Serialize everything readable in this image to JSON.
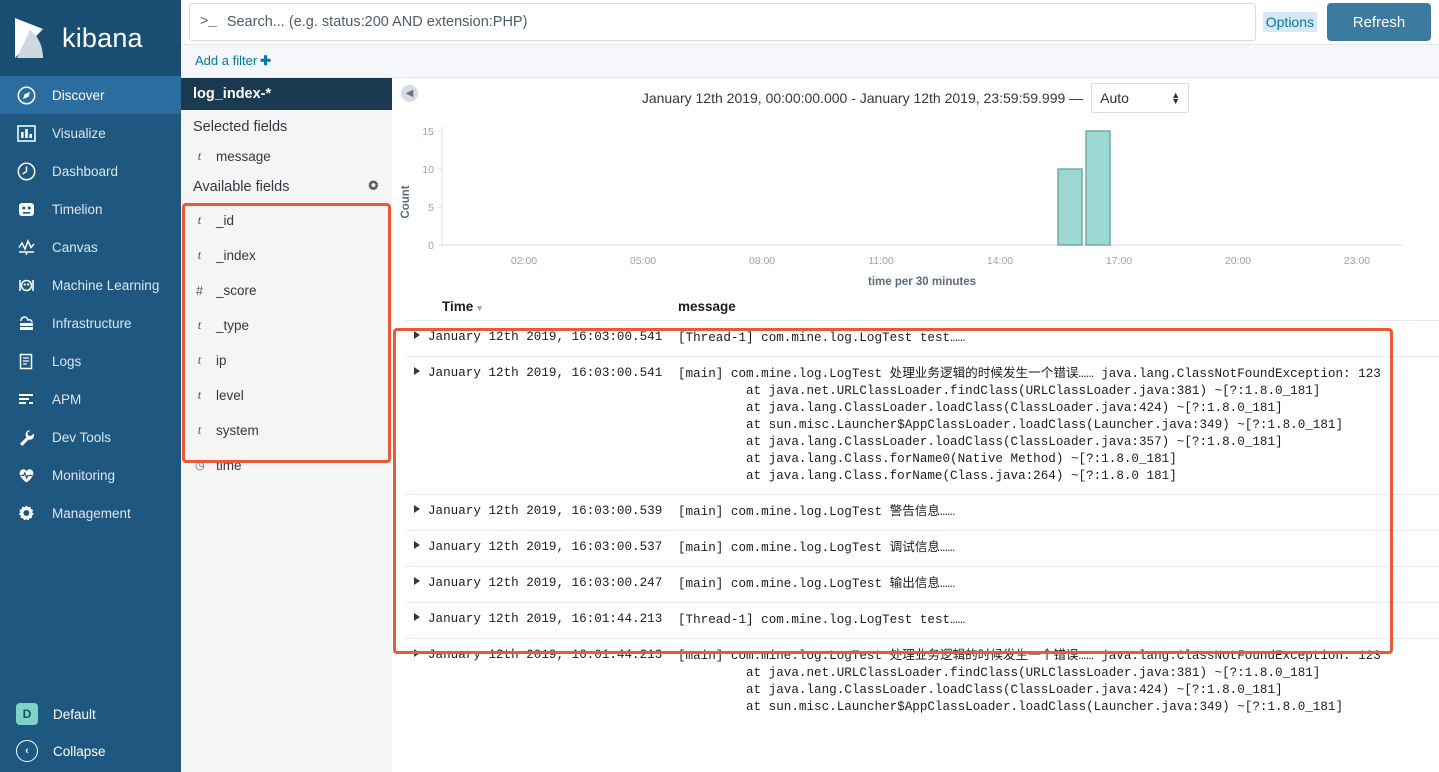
{
  "brand": {
    "name": "kibana",
    "logo_icon": "kibana-logo"
  },
  "nav": {
    "items": [
      {
        "label": "Discover",
        "icon": "compass-icon",
        "active": true
      },
      {
        "label": "Visualize",
        "icon": "bar-chart-icon",
        "active": false
      },
      {
        "label": "Dashboard",
        "icon": "dashboard-icon",
        "active": false
      },
      {
        "label": "Timelion",
        "icon": "timelion-icon",
        "active": false
      },
      {
        "label": "Canvas",
        "icon": "canvas-icon",
        "active": false
      },
      {
        "label": "Machine Learning",
        "icon": "machine-learning-icon",
        "active": false
      },
      {
        "label": "Infrastructure",
        "icon": "infrastructure-icon",
        "active": false
      },
      {
        "label": "Logs",
        "icon": "logs-icon",
        "active": false
      },
      {
        "label": "APM",
        "icon": "apm-icon",
        "active": false
      },
      {
        "label": "Dev Tools",
        "icon": "wrench-icon",
        "active": false
      },
      {
        "label": "Monitoring",
        "icon": "heart-pulse-icon",
        "active": false
      },
      {
        "label": "Management",
        "icon": "gear-icon",
        "active": false
      }
    ],
    "space": {
      "label": "Default",
      "initial": "D",
      "avatar_color": "#7dd3c8"
    }
  },
  "query_bar": {
    "prompt_icon": "terminal-prompt-icon",
    "search_value": "",
    "search_placeholder": "Search... (e.g. status:200 AND extension:PHP)",
    "options_label": "Options",
    "refresh_label": "Refresh"
  },
  "filter_bar": {
    "add_filter_label": "Add a filter",
    "plus_icon": "plus-icon"
  },
  "field_panel": {
    "index_pattern": "log_index-*",
    "selected_fields_label": "Selected fields",
    "selected_fields": [
      {
        "name": "message",
        "type": "t"
      }
    ],
    "available_fields_label": "Available fields",
    "settings_icon": "gear-icon",
    "available_fields": [
      {
        "name": "_id",
        "type": "t"
      },
      {
        "name": "_index",
        "type": "t"
      },
      {
        "name": "_score",
        "type": "#"
      },
      {
        "name": "_type",
        "type": "t"
      },
      {
        "name": "ip",
        "type": "t"
      },
      {
        "name": "level",
        "type": "t"
      },
      {
        "name": "system",
        "type": "t"
      },
      {
        "name": "time",
        "type": "clock"
      }
    ]
  },
  "time_range": {
    "collapse_icon": "chevron-left-circle-icon",
    "text": "January 12th 2019, 00:00:00.000 - January 12th 2019, 23:59:59.999 —",
    "interval_value": "Auto"
  },
  "chart_data": {
    "type": "bar",
    "title": "",
    "xlabel": "time per 30 minutes",
    "ylabel": "Count",
    "ylim": [
      0,
      15
    ],
    "yticks": [
      0,
      5,
      10,
      15
    ],
    "xticks": [
      "02:00",
      "05:00",
      "08:00",
      "11:00",
      "14:00",
      "17:00",
      "20:00",
      "23:00"
    ],
    "categories": [
      "15:30",
      "16:00"
    ],
    "values": [
      10,
      15
    ],
    "bar_fill": "#9ed8d2",
    "bar_stroke": "#68a9a3",
    "grid": false,
    "legend": "none"
  },
  "doc_table": {
    "columns": [
      {
        "key": "time",
        "label": "Time",
        "sorted": true,
        "sort_icon": "sort-caret-icon"
      },
      {
        "key": "message",
        "label": "message",
        "sorted": false
      }
    ],
    "rows": [
      {
        "time": "January 12th 2019, 16:03:00.541",
        "message_lines": [
          "[Thread-1] com.mine.log.LogTest test……"
        ]
      },
      {
        "time": "January 12th 2019, 16:03:00.541",
        "message_lines": [
          "[main] com.mine.log.LogTest 处理业务逻辑的时候发生一个错误…… java.lang.ClassNotFoundException: 123",
          "at java.net.URLClassLoader.findClass(URLClassLoader.java:381) ~[?:1.8.0_181]",
          "at java.lang.ClassLoader.loadClass(ClassLoader.java:424) ~[?:1.8.0_181]",
          "at sun.misc.Launcher$AppClassLoader.loadClass(Launcher.java:349) ~[?:1.8.0_181]",
          "at java.lang.ClassLoader.loadClass(ClassLoader.java:357) ~[?:1.8.0_181]",
          "at java.lang.Class.forName0(Native Method) ~[?:1.8.0_181]",
          "at java.lang.Class.forName(Class.java:264) ~[?:1.8.0 181]"
        ]
      },
      {
        "time": "January 12th 2019, 16:03:00.539",
        "message_lines": [
          "[main] com.mine.log.LogTest 警告信息……"
        ]
      },
      {
        "time": "January 12th 2019, 16:03:00.537",
        "message_lines": [
          "[main] com.mine.log.LogTest 调试信息……"
        ]
      },
      {
        "time": "January 12th 2019, 16:03:00.247",
        "message_lines": [
          "[main] com.mine.log.LogTest 输出信息……"
        ]
      },
      {
        "time": "January 12th 2019, 16:01:44.213",
        "message_lines": [
          "[Thread-1] com.mine.log.LogTest test……"
        ]
      },
      {
        "time": "January 12th 2019, 16:01:44.213",
        "message_lines": [
          "[main] com.mine.log.LogTest 处理业务逻辑的时候发生一个错误…… java.lang.ClassNotFoundException: 123",
          "at java.net.URLClassLoader.findClass(URLClassLoader.java:381) ~[?:1.8.0_181]",
          "at java.lang.ClassLoader.loadClass(ClassLoader.java:424) ~[?:1.8.0_181]",
          "at sun.misc.Launcher$AppClassLoader.loadClass(Launcher.java:349) ~[?:1.8.0_181]"
        ]
      }
    ]
  },
  "annotations": {
    "highlight_color": "#eb5a30",
    "boxes": [
      "available-fields-box",
      "doc-table-box"
    ]
  }
}
